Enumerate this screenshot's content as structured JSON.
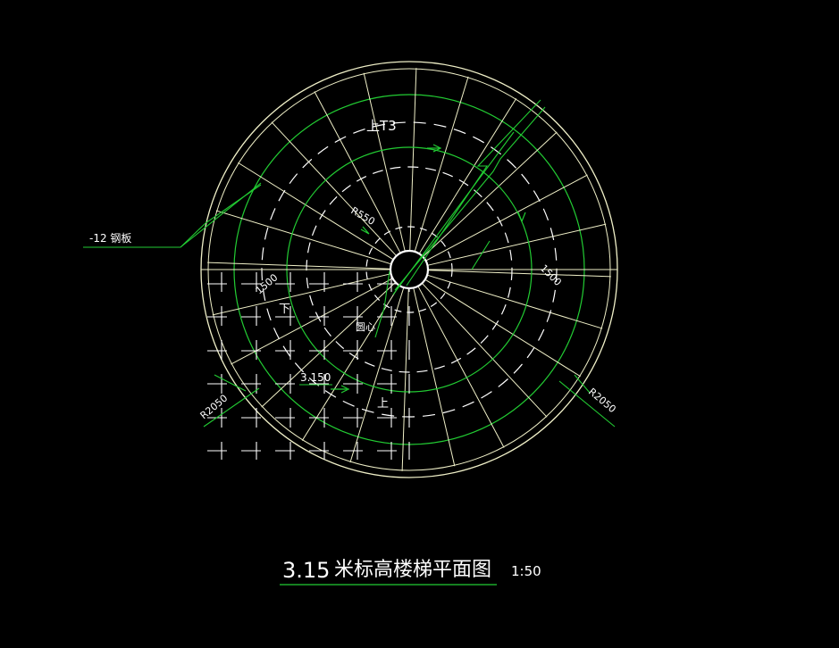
{
  "colors": {
    "background": "#000000",
    "lines": "#f0f0c8",
    "accent": "#22cc33",
    "dashes": "#ffffff"
  },
  "labels": {
    "steel_plate": "-12  钢板",
    "up_label": "上T3",
    "radius_inner": "R550",
    "dim_right": "1500",
    "dim_left": "1500",
    "down": "下",
    "center": "圆心",
    "level": "3.150",
    "up": "上",
    "radius_left": "R2050",
    "radius_right": "R2050"
  },
  "title": {
    "number": "3.15",
    "text": "米标高楼梯平面图",
    "scale": "1:50"
  }
}
